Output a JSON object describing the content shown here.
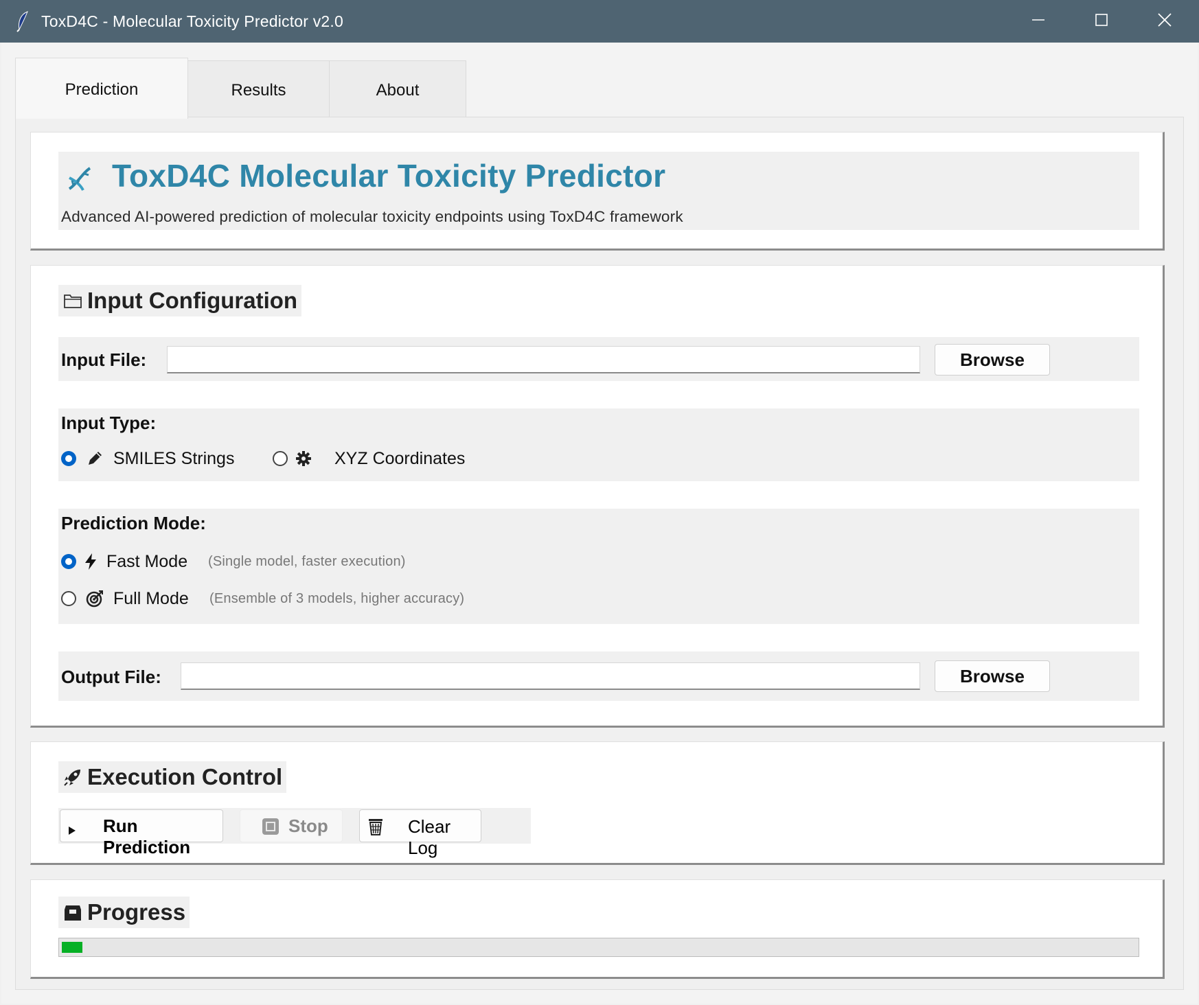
{
  "window": {
    "title": "ToxD4C - Molecular Toxicity Predictor v2.0",
    "icon": "feather-icon",
    "controls": [
      "minimize-icon",
      "maximize-icon",
      "close-icon"
    ]
  },
  "tabs": [
    {
      "label": "Prediction",
      "active": true
    },
    {
      "label": "Results",
      "active": false
    },
    {
      "label": "About",
      "active": false
    }
  ],
  "header": {
    "icon": "dna-icon",
    "title": "ToxD4C Molecular Toxicity Predictor",
    "subtitle": "Advanced AI-powered prediction of molecular toxicity endpoints using ToxD4C framework",
    "title_color": "#2f86a8"
  },
  "input_config": {
    "icon": "folder-icon",
    "title": "Input Configuration",
    "input_file": {
      "label": "Input File:",
      "value": "",
      "browse_label": "Browse"
    },
    "input_type": {
      "label": "Input Type:",
      "options": [
        {
          "label": "SMILES Strings",
          "icon": "pencil-icon",
          "selected": true
        },
        {
          "label": "XYZ Coordinates",
          "icon": "gear-icon",
          "selected": false
        }
      ]
    },
    "prediction_mode": {
      "label": "Prediction Mode:",
      "options": [
        {
          "label": "Fast Mode",
          "hint": "(Single model, faster execution)",
          "icon": "lightning-icon",
          "selected": true
        },
        {
          "label": "Full Mode",
          "hint": "(Ensemble of 3 models, higher accuracy)",
          "icon": "target-icon",
          "selected": false
        }
      ]
    },
    "output_file": {
      "label": "Output File:",
      "value": "",
      "browse_label": "Browse"
    }
  },
  "execution": {
    "icon": "rocket-icon",
    "title": "Execution Control",
    "run_label": "Run Prediction",
    "stop_label": "Stop",
    "clear_label": "Clear Log",
    "stop_enabled": false
  },
  "progress": {
    "icon": "inbox-icon",
    "title": "Progress",
    "fraction": 0.019,
    "bar_color": "#06b025"
  }
}
